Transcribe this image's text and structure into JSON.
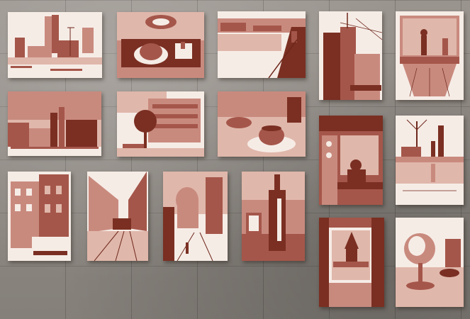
{
  "scene": {
    "wall_color": "#8a8580",
    "paper_color": "#f6ece6",
    "ink_color": "#7a2f22",
    "sketches": [
      {
        "id": "city-skyline-towers",
        "subject": "skyline"
      },
      {
        "id": "cafe-table-cup",
        "subject": "cafe"
      },
      {
        "id": "river-quay",
        "subject": "river"
      },
      {
        "id": "tower-street-corner",
        "subject": "tower"
      },
      {
        "id": "window-figures",
        "subject": "window"
      },
      {
        "id": "wide-city-skyline",
        "subject": "skyline"
      },
      {
        "id": "building-with-tree",
        "subject": "building"
      },
      {
        "id": "coffee-cup-saucer",
        "subject": "cafe"
      },
      {
        "id": "cafe-interior-bench",
        "subject": "interior"
      },
      {
        "id": "rainy-street-trees",
        "subject": "street"
      },
      {
        "id": "apartment-car",
        "subject": "street"
      },
      {
        "id": "boulevard-tram",
        "subject": "street"
      },
      {
        "id": "misty-cathedral",
        "subject": "street"
      },
      {
        "id": "bottle-glass",
        "subject": "still-life"
      },
      {
        "id": "window-pagoda-view",
        "subject": "window"
      },
      {
        "id": "wine-glass",
        "subject": "still-life"
      }
    ]
  }
}
